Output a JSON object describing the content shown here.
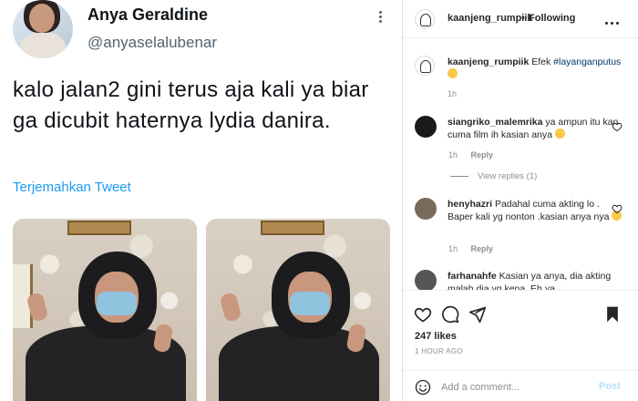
{
  "tweet": {
    "display_name": "Anya Geraldine",
    "handle": "@anyaselalubenar",
    "text": "kalo jalan2 gini terus aja kali ya biar ga dicubit haternya lydia danira.",
    "translate_label": "Terjemahkan Tweet"
  },
  "instagram": {
    "header": {
      "username": "kaanjeng_rumpiik",
      "separator": "•",
      "follow_status": "Following"
    },
    "caption": {
      "username": "kaanjeng_rumpiik",
      "text": "Efek",
      "hashtag": "#layanganputus",
      "time": "1h"
    },
    "comments": [
      {
        "username": "siangriko_malemrika",
        "text": "ya ampun itu kan cuma film ih kasian anya",
        "time": "1h",
        "reply_label": "Reply",
        "avatar_color": "#1a1a1a"
      },
      {
        "username": "henyhazri",
        "text": "Padahal cuma akting lo . Baper kali yg nonton .kasian anya nya",
        "time": "1h",
        "reply_label": "Reply",
        "avatar_color": "#7a6a5c"
      },
      {
        "username": "farhanahfe",
        "text": "Kasian ya anya, dia akting malah dia yg kena. Eh ya",
        "avatar_color": "#555555"
      }
    ],
    "view_replies_label": "View replies (1)",
    "likes": "247 likes",
    "time_ago": "1 HOUR AGO",
    "comment_placeholder": "Add a comment...",
    "post_label": "Post",
    "colors": {
      "hashtag": "#00376b",
      "post_button": "#b2dffc",
      "tweet_link": "#1d9bf0"
    },
    "icons": [
      "heart-icon",
      "comment-icon",
      "share-icon",
      "bookmark-icon",
      "smiley-icon"
    ]
  }
}
